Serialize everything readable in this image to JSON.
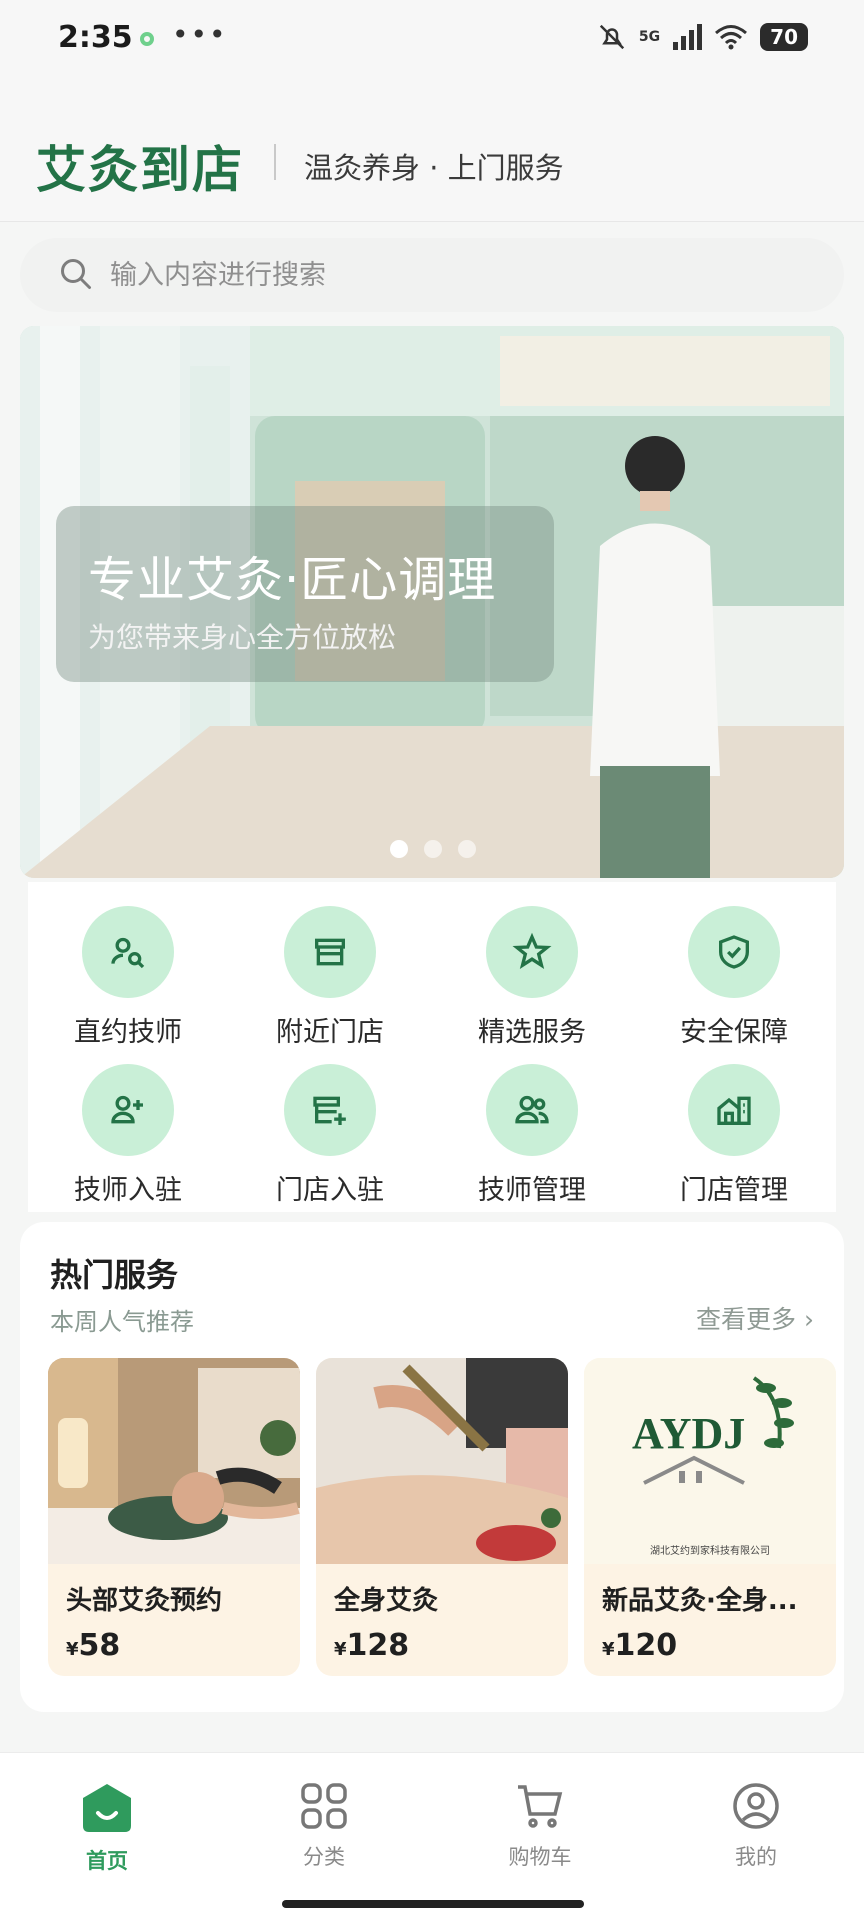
{
  "status_bar": {
    "time": "2:35",
    "more": "•••",
    "battery": "70",
    "network": "5G"
  },
  "header": {
    "brand": "艾灸到店",
    "tagline": "温灸养身 · 上门服务"
  },
  "search": {
    "placeholder": "输入内容进行搜索"
  },
  "banner": {
    "title": "专业艾灸·匠心调理",
    "subtitle": "为您带来身心全方位放松",
    "active_slide": 1,
    "slides": 3
  },
  "quick_actions": [
    {
      "label": "直约技师",
      "icon": "technician-search-icon"
    },
    {
      "label": "附近门店",
      "icon": "store-icon"
    },
    {
      "label": "精选服务",
      "icon": "star-icon"
    },
    {
      "label": "安全保障",
      "icon": "shield-check-icon"
    },
    {
      "label": "技师入驻",
      "icon": "add-user-icon"
    },
    {
      "label": "门店入驻",
      "icon": "add-store-icon"
    },
    {
      "label": "技师管理",
      "icon": "users-icon"
    },
    {
      "label": "门店管理",
      "icon": "building-icon"
    }
  ],
  "hot": {
    "title": "热门服务",
    "subtitle": "本周人气推荐",
    "more": "查看更多 ›",
    "items": [
      {
        "name": "头部艾灸预约",
        "currency": "¥",
        "price": "58"
      },
      {
        "name": "全身艾灸",
        "currency": "¥",
        "price": "128"
      },
      {
        "name": "新品艾灸·全身...",
        "currency": "¥",
        "price": "120",
        "logo_text": "AYDJ",
        "company": "湖北艾约到家科技有限公司"
      }
    ]
  },
  "tabs": [
    {
      "label": "首页",
      "icon": "home-icon",
      "active": true
    },
    {
      "label": "分类",
      "icon": "grid-icon",
      "active": false
    },
    {
      "label": "购物车",
      "icon": "cart-icon",
      "active": false
    },
    {
      "label": "我的",
      "icon": "profile-icon",
      "active": false
    }
  ],
  "colors": {
    "brand": "#237347",
    "accent": "#2f9b5d",
    "icon_bg": "#c9efd7",
    "card_bg": "#fdf3e4"
  }
}
